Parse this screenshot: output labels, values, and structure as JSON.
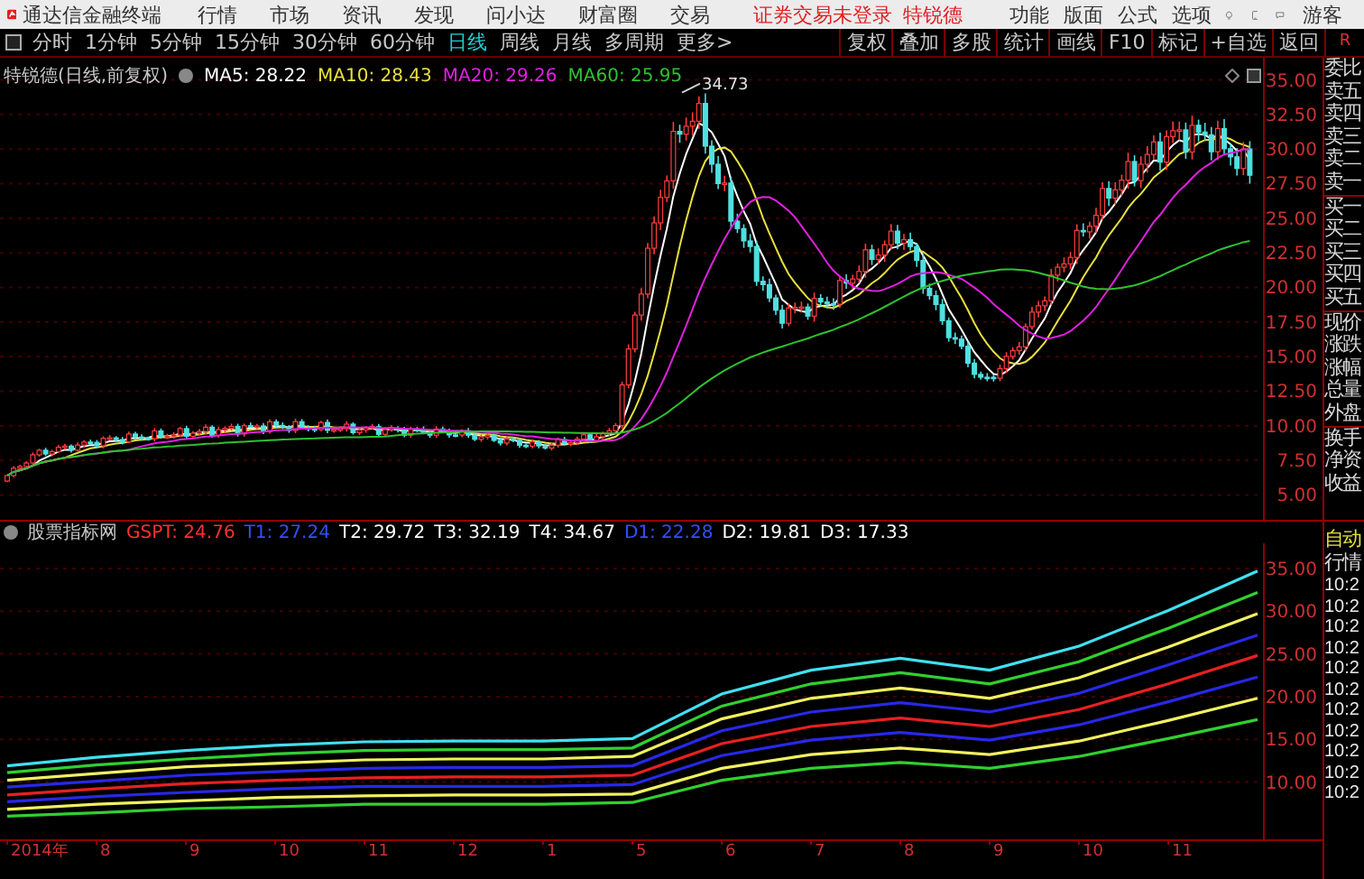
{
  "menubar": {
    "app_title": "通达信金融终端",
    "menus": [
      "行情",
      "市场",
      "资讯",
      "发现",
      "问小达",
      "财富圈",
      "交易"
    ],
    "notice": "证券交易未登录",
    "stock_link": "特锐德",
    "tools": [
      "功能",
      "版面",
      "公式",
      "选项"
    ],
    "user": "游客"
  },
  "toolbar": {
    "periods": [
      {
        "label": "分时",
        "selected": false
      },
      {
        "label": "1分钟",
        "selected": false
      },
      {
        "label": "5分钟",
        "selected": false
      },
      {
        "label": "15分钟",
        "selected": false
      },
      {
        "label": "30分钟",
        "selected": false
      },
      {
        "label": "60分钟",
        "selected": false
      },
      {
        "label": "日线",
        "selected": true
      },
      {
        "label": "周线",
        "selected": false
      },
      {
        "label": "月线",
        "selected": false
      },
      {
        "label": "多周期",
        "selected": false
      },
      {
        "label": "更多>",
        "selected": false
      }
    ],
    "buttons": [
      "复权",
      "叠加",
      "多股",
      "统计",
      "画线",
      "F10",
      "标记",
      "+自选",
      "返回"
    ],
    "corner": "R"
  },
  "kline": {
    "title": "特锐德(日线,前复权)",
    "ma": [
      {
        "label": "MA5: 28.22",
        "color": "#ffffff"
      },
      {
        "label": "MA10: 28.43",
        "color": "#e8e040"
      },
      {
        "label": "MA20: 29.26",
        "color": "#e020e0"
      },
      {
        "label": "MA60: 25.95",
        "color": "#30c030"
      }
    ],
    "peak_label": "34.73",
    "price_axis": [
      "35.00",
      "32.50",
      "30.00",
      "27.50",
      "25.00",
      "22.50",
      "20.00",
      "17.50",
      "15.00",
      "12.50",
      "10.00",
      "7.50",
      "5.00"
    ]
  },
  "indicator": {
    "title": "股票指标网",
    "legend": [
      {
        "label": "GSPT: 24.76",
        "color": "#ff3030"
      },
      {
        "label": "T1: 27.24",
        "color": "#3050ff"
      },
      {
        "label": "T2: 29.72",
        "color": "#ffffff"
      },
      {
        "label": "T3: 32.19",
        "color": "#ffffff"
      },
      {
        "label": "T4: 34.67",
        "color": "#ffffff"
      },
      {
        "label": "D1: 22.28",
        "color": "#3050ff"
      },
      {
        "label": "D2: 19.81",
        "color": "#ffffff"
      },
      {
        "label": "D3: 17.33",
        "color": "#ffffff"
      }
    ],
    "chart_data": {
      "type": "line",
      "grid": true,
      "categories": [
        "2014年",
        "8",
        "9",
        "10",
        "11",
        "12",
        "1",
        "5",
        "6",
        "7",
        "8",
        "9",
        "10",
        "11",
        null
      ],
      "ylim": [
        3.3,
        37.95
      ],
      "yticks": [
        {
          "value": 35,
          "label": "35.00"
        },
        {
          "value": 30,
          "label": "30.00"
        },
        {
          "value": 25,
          "label": "25.00"
        },
        {
          "value": 20,
          "label": "20.00"
        },
        {
          "value": 15,
          "label": "15.00"
        },
        {
          "value": 10,
          "label": "10.00"
        }
      ],
      "series": [
        {
          "color": "#40e0f0",
          "values": [
            11.9,
            12.9,
            13.7,
            14.3,
            14.7,
            14.8,
            14.8,
            15.1,
            20.3,
            23.1,
            24.5,
            23.1,
            25.9,
            30.1,
            34.7
          ]
        },
        {
          "color": "#30d030",
          "values": [
            11.1,
            12.0,
            12.7,
            13.3,
            13.7,
            13.8,
            13.8,
            14.0,
            18.9,
            21.5,
            22.8,
            21.5,
            24.1,
            28.0,
            32.2
          ]
        },
        {
          "color": "#f0f060",
          "values": [
            10.2,
            11.0,
            11.8,
            12.2,
            12.6,
            12.7,
            12.7,
            13.0,
            17.4,
            19.8,
            21.0,
            19.8,
            22.2,
            25.8,
            29.7
          ]
        },
        {
          "color": "#2828e8",
          "values": [
            9.4,
            10.1,
            10.8,
            11.2,
            11.6,
            11.7,
            11.7,
            11.9,
            16.0,
            18.2,
            19.3,
            18.2,
            20.4,
            23.7,
            27.2
          ]
        },
        {
          "color": "#e82020",
          "values": [
            8.5,
            9.2,
            9.8,
            10.2,
            10.5,
            10.6,
            10.6,
            10.8,
            14.5,
            16.5,
            17.5,
            16.5,
            18.5,
            21.5,
            24.8
          ]
        },
        {
          "color": "#2828e8",
          "values": [
            7.7,
            8.3,
            8.8,
            9.2,
            9.5,
            9.5,
            9.5,
            9.7,
            13.1,
            14.9,
            15.8,
            14.9,
            16.7,
            19.4,
            22.3
          ]
        },
        {
          "color": "#f0f060",
          "values": [
            6.8,
            7.4,
            7.8,
            8.2,
            8.4,
            8.5,
            8.5,
            8.6,
            11.6,
            13.2,
            14.0,
            13.2,
            14.8,
            17.2,
            19.8
          ]
        },
        {
          "color": "#30d030",
          "values": [
            6.0,
            6.4,
            6.9,
            7.1,
            7.4,
            7.4,
            7.4,
            7.6,
            10.2,
            11.6,
            12.3,
            11.6,
            13.0,
            15.1,
            17.3
          ]
        }
      ]
    }
  },
  "quote_panel": {
    "fields": [
      "委比",
      "卖五",
      "卖四",
      "卖三",
      "卖二",
      "卖一",
      "买一",
      "买二",
      "买三",
      "买四",
      "买五",
      "现价",
      "涨跌",
      "涨幅",
      "总量",
      "外盘",
      "换手",
      "净资",
      "收益"
    ],
    "auto": "自动",
    "market": "行情",
    "ticks": [
      "10:2",
      "10:2",
      "10:2",
      "10:2",
      "10:2",
      "10:2",
      "10:2",
      "10:2",
      "10:2",
      "10:2",
      "10:2"
    ]
  }
}
